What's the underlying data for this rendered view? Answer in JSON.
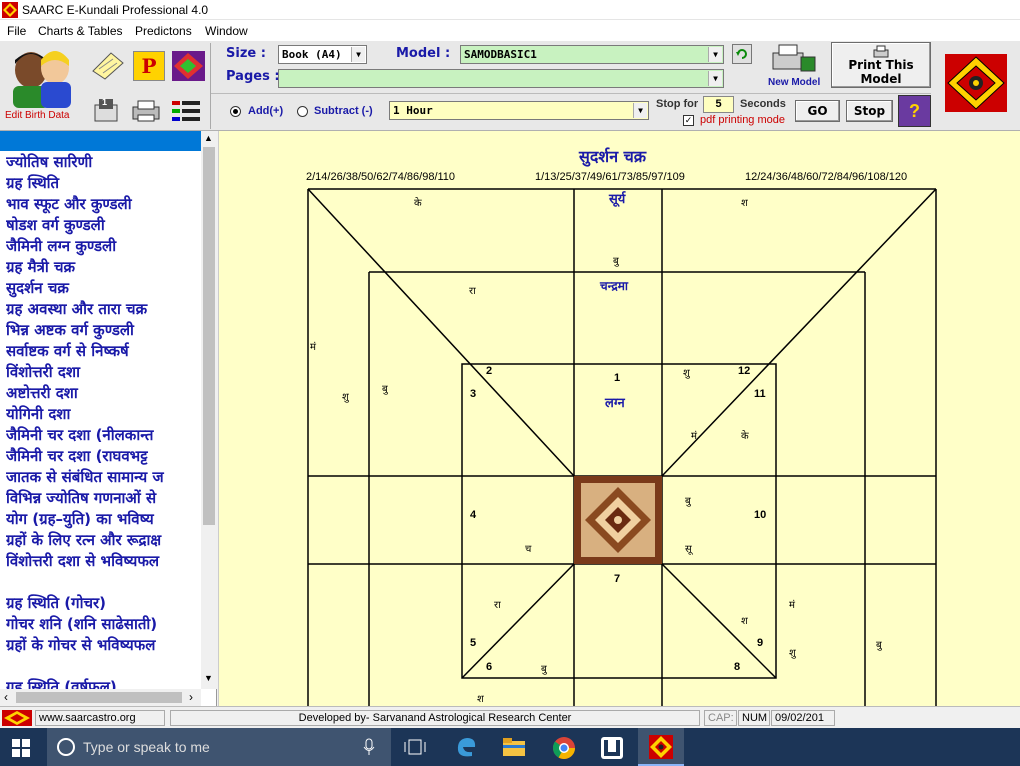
{
  "window": {
    "title": "SAARC E-Kundali Professional 4.0"
  },
  "menu": [
    "File",
    "Charts & Tables",
    "Predictons",
    "Window"
  ],
  "toolbar": {
    "edit_birth_label": "Edit Birth Data",
    "size_label": "Size :",
    "size_value": "Book (A4)",
    "model_label": "Model :",
    "model_value": "SAMODBASIC1",
    "pages_label": "Pages :",
    "pages_value": "",
    "new_model_label": "New Model",
    "print_model_label_1": "Print This",
    "print_model_label_2": "Model",
    "add_label": "Add(+)",
    "subtract_label": "Subtract (-)",
    "interval_value": "1 Hour",
    "stop_for_label": "Stop for",
    "stop_for_value": "5",
    "seconds_label": "Seconds",
    "pdf_label": "pdf printing mode",
    "go_label": "GO",
    "stop_label": "Stop",
    "help_glyph": "?",
    "page_number": "1"
  },
  "sidebar": {
    "items": [
      "",
      "ज्योतिष सारिणी",
      "ग्रह स्थिति",
      "भाव स्फूट और कुण्डली",
      "षोडश वर्ग कुण्डली",
      "जैमिनी लग्न कुण्डली",
      "ग्रह मैत्री चक्र",
      "सुदर्शन चक्र",
      "ग्रह अवस्था और तारा चक्र",
      "भिन्न अष्टक वर्ग कुण्डली",
      "सर्वाष्टक वर्ग से निष्कर्ष",
      "विंशोत्तरी दशा",
      "अष्टोत्तरी दशा",
      "योगिनी दशा",
      "जैमिनी चर दशा (नीलकान्त",
      "जैमिनी चर दशा (राघवभट्ट",
      "जातक से संबंधित सामान्य ज",
      "विभिन्न ज्योतिष गणनाओं से",
      "योग (ग्रह–युति) का भविष्य",
      "ग्रहों के लिए रत्न और रूद्राक्ष",
      "विंशोत्तरी दशा से भविष्यफल",
      "",
      "ग्रह स्थिति (गोचर)",
      "गोचर शनि (शनि साढेसाती)",
      "ग्रहों के गोचर से भविष्यफल",
      "",
      "ग्रह स्थिति (वर्षफल)"
    ]
  },
  "chart": {
    "title": "सुदर्शन चक्र",
    "header_left": "2/14/26/38/50/62/74/86/98/110",
    "header_mid": "1/13/25/37/49/61/73/85/97/109",
    "header_right": "12/24/36/48/60/72/84/96/108/120",
    "planets": {
      "outer_ke": "के",
      "outer_sha": "श",
      "outer_surya": "सूर्य",
      "mid_ra": "रा",
      "mid_bu": "बु",
      "mid_chandrama": "चन्द्रमा",
      "outer_mam": "मं",
      "mid_shu": "शु",
      "mid_bu2": "बु",
      "in_shu": "शु",
      "in_mam": "मं",
      "in_ke": "के",
      "lagna": "लग्न",
      "in_bu": "बु",
      "in_su": "सू",
      "in_cha": "च",
      "in_ra": "रा",
      "in_bu3": "बु",
      "in_sha": "श",
      "mid_mam": "मं",
      "mid_shu2": "शु",
      "outer_bu": "बु",
      "bottom_sha": "श"
    },
    "houses": [
      "1",
      "2",
      "3",
      "4",
      "5",
      "6",
      "7",
      "8",
      "9",
      "10",
      "11",
      "12"
    ]
  },
  "statusbar": {
    "url": "www.saarcastro.org",
    "developer": "Developed by- Sarvanand Astrological Research Center",
    "cap": "CAP:",
    "num": "NUM",
    "date": "09/02/201"
  },
  "taskbar": {
    "search_placeholder": "Type or speak to me"
  },
  "colors": {
    "accent": "#1a1aa8",
    "chart_bg": "#ffffc8",
    "brand_red": "#cc0000"
  }
}
